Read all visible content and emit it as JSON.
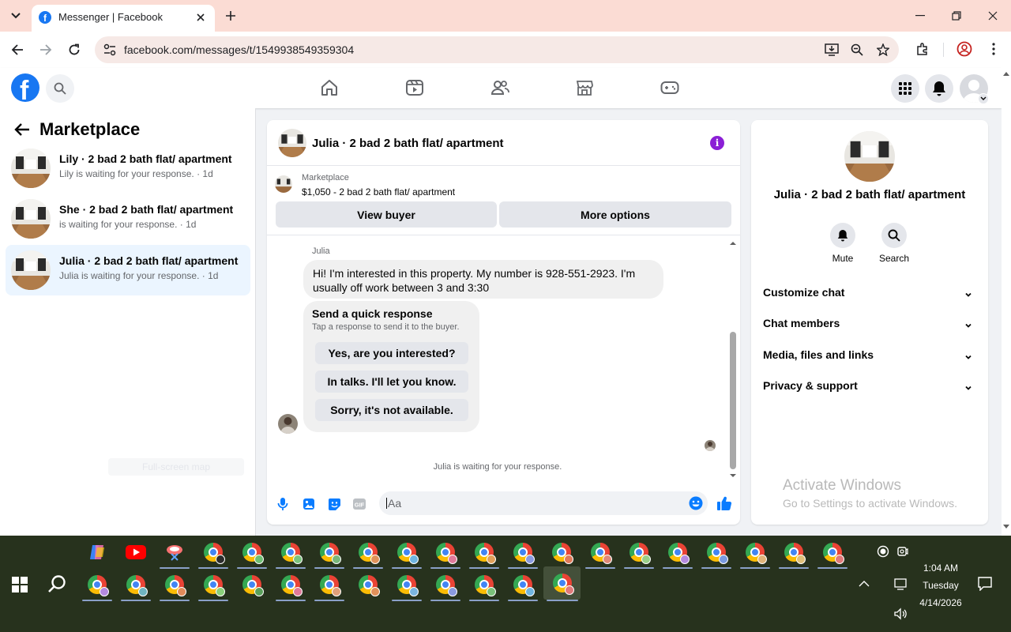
{
  "browser": {
    "tab_title": "Messenger | Facebook",
    "url": "facebook.com/messages/t/1549938549359304"
  },
  "left_panel": {
    "title": "Marketplace",
    "conversations": [
      {
        "title": "Lily · 2 bad 2 bath flat/ apartment",
        "subtitle": "Lily is waiting for your response. · 1d",
        "active": false
      },
      {
        "title": "She · 2 bad 2 bath flat/ apartment",
        "subtitle": "is waiting for your response. · 1d",
        "active": false
      },
      {
        "title": "Julia · 2 bad 2 bath flat/ apartment",
        "subtitle": "Julia is waiting for your response. · 1d",
        "active": true
      }
    ],
    "faded_label": "Full-screen map"
  },
  "chat": {
    "header_title": "Julia · 2 bad 2 bath flat/ apartment",
    "marketplace_label": "Marketplace",
    "listing": "$1,050 - 2 bad 2 bath flat/ apartment",
    "view_buyer": "View buyer",
    "more_options": "More options",
    "sender": "Julia",
    "message": "Hi! I'm interested in this property. My number is 928-551-2923. I'm usually off work between 3 and 3:30",
    "quick_title": "Send a quick response",
    "quick_sub": "Tap a response to send it to the buyer.",
    "quick_replies": [
      "Yes, are you interested?",
      "In talks. I'll let you know.",
      "Sorry, it's not available."
    ],
    "waiting": "Julia is waiting for your response.",
    "input_placeholder": "Aa"
  },
  "right_panel": {
    "title": "Julia · 2 bad 2 bath flat/ apartment",
    "actions": [
      "Mute",
      "Search"
    ],
    "sections": [
      "Customize chat",
      "Chat members",
      "Media, files and links",
      "Privacy & support"
    ]
  },
  "watermark": {
    "line1": "Activate Windows",
    "line2": "Go to Settings to activate Windows."
  },
  "taskbar": {
    "time": "1:04 AM",
    "day": "Tuesday",
    "date": "4/14/2026"
  },
  "colors": {
    "facebook_blue": "#1877f2",
    "info_purple": "#8b1fd6",
    "tab_bar": "#fbdcd4",
    "taskbar": "#27321d"
  }
}
